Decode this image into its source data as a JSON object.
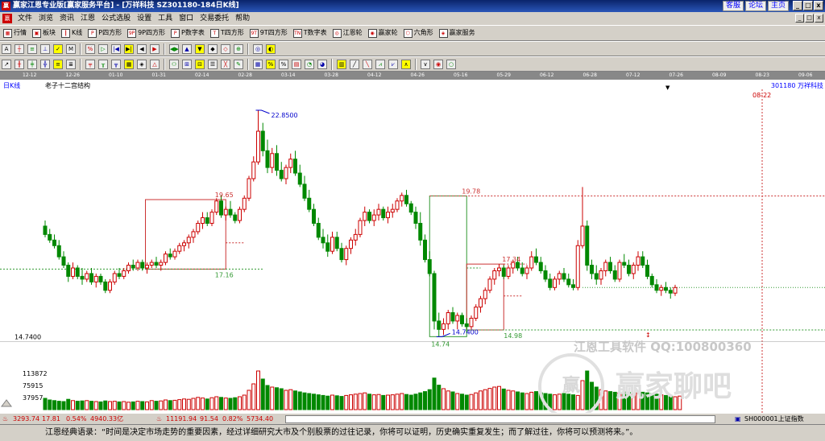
{
  "titlebar": {
    "app_icon": "赢",
    "title": "赢家江恩专业版[赢家服务平台] - [万祥科技   SZ301180-184日K线]",
    "links": [
      "客服",
      "论坛",
      "主页"
    ],
    "win_buttons": [
      "_",
      "□",
      "x"
    ]
  },
  "menubar": {
    "icon": "赢",
    "items": [
      "文件",
      "浏览",
      "资讯",
      "江恩",
      "公式选股",
      "设置",
      "工具",
      "窗口",
      "交易委托",
      "帮助"
    ],
    "mdi_buttons": [
      "_",
      "□",
      "x"
    ]
  },
  "toolbar1": {
    "buttons": [
      {
        "icon": "grid-icon",
        "label": "行情"
      },
      {
        "icon": "blocks-icon",
        "label": "板块"
      },
      {
        "icon": "kline-icon",
        "label": "K线"
      },
      {
        "icon": "p-square-icon",
        "label": "P四方形"
      },
      {
        "icon": "9p-square-icon",
        "label": "9P四方形"
      },
      {
        "icon": "p-number-table-icon",
        "label": "P数字表"
      },
      {
        "icon": "t-square-icon",
        "label": "T四方形"
      },
      {
        "icon": "9t-square-icon",
        "label": "9T四方形"
      },
      {
        "icon": "t-number-table-icon",
        "label": "T数字表"
      },
      {
        "icon": "gann-wheel-icon",
        "label": "江恩轮"
      },
      {
        "icon": "winner-wheel-icon",
        "label": "赢家轮"
      },
      {
        "icon": "hexagon-icon",
        "label": "六角形"
      },
      {
        "icon": "winner-service-icon",
        "label": "赢家服务"
      }
    ]
  },
  "toolbar2": {
    "icons": [
      "A",
      "┼",
      "≡",
      "⊥",
      "✓",
      "M",
      "%",
      "▷",
      "|◀",
      "▶|",
      "◀",
      "▶",
      "◀▶",
      "▲",
      "▼",
      "◆",
      "◇",
      "⊕",
      "◎",
      "◐"
    ]
  },
  "toolbar3": {
    "icons": [
      "↗",
      "╫",
      "╪",
      "╬",
      "≡",
      "≣",
      "╤",
      "╥",
      "╦",
      "▦",
      "◈",
      "△",
      "⚇",
      "⊞",
      "⊟",
      "☰",
      "╳",
      "✎",
      "▦",
      "%",
      "%",
      "▤",
      "◔",
      "◕",
      "▥",
      "╱",
      "╲",
      "⩘",
      "⩗",
      "∧",
      "∨",
      "◉",
      "○"
    ]
  },
  "chart_header": {
    "period": "日K线",
    "indicator_title": "老子十二宫结构",
    "stock": "301180 万祥科技",
    "date_marker": "08-22"
  },
  "date_axis": [
    "12-12",
    "12-26",
    "01-10",
    "01-31",
    "02-14",
    "02-28",
    "03-14",
    "03-28",
    "04-12",
    "04-26",
    "05-16",
    "05-29",
    "06-12",
    "06-28",
    "07-12",
    "07-26",
    "08-09",
    "08-23",
    "09-06"
  ],
  "chart_data": {
    "type": "candlestick",
    "title": "老子十二宫结构",
    "ylabel": "",
    "ylim": [
      14.0,
      23.6
    ],
    "price_axis_label": "14.7400",
    "up_color": "#cc0000",
    "down_color": "#008800",
    "annotations": {
      "high": "22.8500",
      "low": "14.7400",
      "box_labels": [
        "19.65",
        "17.16",
        "19.78",
        "14.74",
        "17.34",
        "14.98"
      ]
    },
    "candles": [
      [
        18.7,
        18.9,
        18.3,
        18.4
      ],
      [
        18.4,
        18.6,
        18.1,
        18.2
      ],
      [
        18.2,
        18.4,
        17.9,
        18.0
      ],
      [
        18.0,
        18.2,
        17.5,
        17.6
      ],
      [
        17.6,
        17.8,
        17.2,
        17.3
      ],
      [
        17.3,
        17.4,
        16.7,
        16.9
      ],
      [
        16.9,
        17.4,
        16.8,
        17.2
      ],
      [
        17.2,
        17.3,
        16.8,
        16.9
      ],
      [
        16.9,
        17.2,
        16.6,
        16.8
      ],
      [
        16.8,
        17.1,
        16.7,
        17.0
      ],
      [
        17.0,
        17.2,
        16.6,
        16.7
      ],
      [
        16.7,
        17.0,
        16.5,
        16.9
      ],
      [
        16.9,
        17.0,
        16.6,
        16.7
      ],
      [
        16.7,
        16.8,
        16.3,
        16.4
      ],
      [
        16.4,
        16.8,
        16.3,
        16.7
      ],
      [
        16.7,
        17.1,
        16.6,
        17.0
      ],
      [
        17.0,
        17.2,
        16.8,
        16.9
      ],
      [
        16.9,
        17.2,
        16.8,
        17.1
      ],
      [
        17.1,
        17.4,
        17.0,
        17.3
      ],
      [
        17.3,
        17.5,
        17.1,
        17.2
      ],
      [
        17.2,
        17.5,
        17.1,
        17.4
      ],
      [
        17.4,
        17.5,
        17.1,
        17.2
      ],
      [
        17.2,
        17.4,
        17.0,
        17.3
      ],
      [
        17.3,
        17.5,
        17.2,
        17.4
      ],
      [
        17.4,
        17.6,
        17.2,
        17.3
      ],
      [
        17.3,
        17.5,
        17.1,
        17.4
      ],
      [
        17.4,
        17.8,
        17.3,
        17.7
      ],
      [
        17.7,
        17.9,
        17.5,
        17.6
      ],
      [
        17.6,
        17.9,
        17.5,
        17.8
      ],
      [
        17.8,
        18.1,
        17.7,
        18.0
      ],
      [
        18.0,
        18.2,
        17.8,
        18.1
      ],
      [
        18.1,
        18.4,
        17.9,
        18.3
      ],
      [
        18.3,
        18.6,
        18.1,
        18.5
      ],
      [
        18.5,
        18.9,
        18.4,
        18.8
      ],
      [
        18.8,
        19.2,
        18.6,
        19.0
      ],
      [
        19.0,
        19.2,
        18.7,
        18.8
      ],
      [
        18.8,
        19.3,
        18.7,
        19.2
      ],
      [
        19.2,
        19.7,
        19.1,
        19.6
      ],
      [
        19.6,
        19.8,
        19.0,
        19.1
      ],
      [
        19.1,
        19.4,
        18.9,
        19.3
      ],
      [
        19.3,
        19.6,
        19.0,
        19.1
      ],
      [
        19.1,
        19.2,
        18.8,
        18.9
      ],
      [
        18.9,
        19.4,
        18.8,
        19.3
      ],
      [
        19.3,
        19.8,
        19.2,
        19.7
      ],
      [
        19.7,
        20.5,
        19.6,
        20.4
      ],
      [
        20.4,
        21.2,
        20.3,
        21.0
      ],
      [
        21.0,
        22.85,
        20.9,
        22.1
      ],
      [
        22.1,
        22.4,
        21.2,
        21.4
      ],
      [
        21.4,
        21.8,
        20.6,
        20.8
      ],
      [
        20.8,
        21.5,
        20.6,
        21.3
      ],
      [
        21.3,
        21.6,
        20.5,
        20.7
      ],
      [
        20.7,
        21.0,
        20.3,
        20.4
      ],
      [
        20.4,
        20.9,
        20.2,
        20.8
      ],
      [
        20.8,
        21.3,
        20.6,
        21.1
      ],
      [
        21.1,
        21.4,
        20.5,
        20.6
      ],
      [
        20.6,
        20.9,
        20.1,
        20.2
      ],
      [
        20.2,
        20.5,
        19.6,
        19.7
      ],
      [
        19.7,
        20.0,
        19.2,
        19.3
      ],
      [
        19.3,
        19.5,
        18.7,
        18.8
      ],
      [
        18.8,
        19.0,
        18.2,
        18.3
      ],
      [
        18.3,
        18.6,
        17.9,
        18.1
      ],
      [
        18.1,
        18.4,
        17.6,
        17.8
      ],
      [
        17.8,
        18.5,
        17.7,
        18.3
      ],
      [
        18.3,
        18.5,
        17.8,
        17.9
      ],
      [
        17.9,
        18.1,
        17.4,
        17.5
      ],
      [
        17.5,
        18.0,
        17.3,
        17.9
      ],
      [
        17.9,
        18.3,
        17.7,
        18.2
      ],
      [
        18.2,
        18.6,
        18.0,
        18.4
      ],
      [
        18.4,
        19.0,
        18.3,
        18.9
      ],
      [
        18.9,
        19.4,
        18.7,
        19.2
      ],
      [
        19.2,
        19.3,
        18.8,
        18.9
      ],
      [
        18.9,
        19.3,
        18.7,
        19.1
      ],
      [
        19.1,
        19.5,
        18.9,
        19.3
      ],
      [
        19.3,
        19.4,
        18.9,
        19.0
      ],
      [
        19.0,
        19.4,
        18.8,
        19.2
      ],
      [
        19.2,
        19.5,
        19.0,
        19.3
      ],
      [
        19.3,
        19.7,
        19.2,
        19.6
      ],
      [
        19.6,
        19.9,
        19.4,
        19.8
      ],
      [
        19.8,
        20.0,
        19.4,
        19.5
      ],
      [
        19.5,
        19.6,
        19.1,
        19.2
      ],
      [
        19.2,
        19.4,
        18.6,
        18.8
      ],
      [
        18.8,
        19.2,
        18.0,
        18.2
      ],
      [
        18.2,
        18.4,
        17.4,
        17.5
      ],
      [
        17.5,
        17.8,
        16.9,
        17.0
      ],
      [
        17.0,
        17.1,
        15.0,
        15.3
      ],
      [
        15.3,
        15.6,
        14.74,
        15.0
      ],
      [
        15.0,
        15.4,
        14.8,
        15.2
      ],
      [
        15.2,
        15.7,
        15.0,
        15.6
      ],
      [
        15.6,
        15.8,
        15.2,
        15.3
      ],
      [
        15.3,
        15.6,
        15.0,
        15.5
      ],
      [
        15.5,
        15.6,
        15.1,
        15.2
      ],
      [
        15.2,
        15.4,
        14.9,
        15.1
      ],
      [
        15.1,
        15.5,
        15.0,
        15.4
      ],
      [
        15.4,
        15.9,
        15.3,
        15.8
      ],
      [
        15.8,
        16.2,
        15.6,
        16.1
      ],
      [
        16.1,
        16.5,
        15.9,
        16.4
      ],
      [
        16.4,
        16.9,
        16.3,
        16.8
      ],
      [
        16.8,
        17.2,
        16.6,
        17.1
      ],
      [
        17.1,
        17.34,
        16.9,
        17.2
      ],
      [
        17.2,
        17.3,
        16.8,
        16.9
      ],
      [
        16.9,
        17.3,
        16.8,
        17.2
      ],
      [
        17.2,
        17.5,
        17.0,
        17.4
      ],
      [
        17.4,
        17.6,
        17.1,
        17.2
      ],
      [
        17.2,
        17.4,
        16.9,
        17.0
      ],
      [
        17.0,
        17.3,
        16.8,
        17.2
      ],
      [
        17.2,
        17.8,
        17.1,
        17.6
      ],
      [
        17.6,
        17.9,
        17.3,
        17.4
      ],
      [
        17.4,
        17.6,
        17.0,
        17.1
      ],
      [
        17.1,
        17.3,
        16.7,
        16.8
      ],
      [
        16.8,
        17.0,
        16.4,
        16.5
      ],
      [
        16.5,
        16.9,
        16.4,
        16.8
      ],
      [
        16.8,
        17.1,
        16.6,
        17.0
      ],
      [
        17.0,
        17.2,
        16.7,
        16.8
      ],
      [
        16.8,
        17.0,
        16.5,
        16.6
      ],
      [
        16.6,
        16.8,
        16.4,
        16.5
      ],
      [
        16.5,
        18.2,
        16.4,
        18.0
      ],
      [
        18.0,
        20.1,
        17.9,
        18.7
      ],
      [
        18.7,
        18.9,
        17.1,
        17.3
      ],
      [
        17.3,
        17.5,
        16.8,
        17.0
      ],
      [
        17.0,
        17.3,
        16.6,
        16.8
      ],
      [
        16.8,
        17.2,
        16.6,
        17.1
      ],
      [
        17.1,
        17.5,
        16.9,
        17.4
      ],
      [
        17.4,
        17.6,
        17.0,
        17.1
      ],
      [
        17.1,
        17.3,
        16.7,
        16.8
      ],
      [
        16.8,
        17.5,
        16.7,
        17.4
      ],
      [
        17.4,
        17.7,
        17.2,
        17.3
      ],
      [
        17.3,
        17.5,
        16.9,
        17.0
      ],
      [
        17.0,
        17.4,
        16.8,
        17.3
      ],
      [
        17.3,
        17.8,
        17.1,
        17.6
      ],
      [
        17.6,
        17.8,
        17.2,
        17.3
      ],
      [
        17.3,
        17.5,
        16.8,
        16.9
      ],
      [
        16.9,
        17.0,
        16.5,
        16.6
      ],
      [
        16.6,
        16.8,
        16.3,
        16.4
      ],
      [
        16.4,
        16.6,
        16.2,
        16.5
      ],
      [
        16.5,
        16.7,
        16.3,
        16.4
      ],
      [
        16.4,
        16.5,
        16.1,
        16.3
      ],
      [
        16.3,
        16.6,
        16.2,
        16.5
      ]
    ],
    "volume_axis": [
      "113872",
      "75915",
      "37957"
    ],
    "volume": [
      35,
      30,
      28,
      26,
      25,
      32,
      28,
      26,
      27,
      28,
      26,
      25,
      24,
      27,
      25,
      26,
      24,
      25,
      23,
      24,
      26,
      25,
      24,
      28,
      26,
      27,
      30,
      28,
      29,
      31,
      33,
      32,
      35,
      38,
      36,
      33,
      37,
      40,
      38,
      36,
      35,
      37,
      40,
      45,
      60,
      80,
      120,
      95,
      75,
      70,
      68,
      65,
      60,
      62,
      58,
      55,
      52,
      50,
      48,
      46,
      44,
      42,
      45,
      43,
      41,
      44,
      46,
      48,
      50,
      52,
      48,
      46,
      47,
      44,
      45,
      46,
      48,
      50,
      47,
      45,
      48,
      52,
      56,
      62,
      98,
      76,
      65,
      58,
      55,
      50,
      48,
      45,
      47,
      52,
      58,
      62,
      66,
      70,
      72,
      64,
      60,
      58,
      55,
      52,
      50,
      54,
      56,
      52,
      50,
      48,
      46,
      48,
      50,
      48,
      46,
      44,
      90,
      120,
      85,
      70,
      62,
      58,
      56,
      54,
      52,
      55,
      53,
      50,
      52,
      54,
      52,
      50,
      48,
      46,
      44,
      42,
      40,
      42
    ]
  },
  "statusbar": {
    "icon": "flame-icon",
    "sh_index": "3293.74",
    "sh_change": "17.81",
    "sh_pct": "0.54%",
    "sh_amount": "4940.33亿",
    "sz_index": "11191.94",
    "sz_change": "91.54",
    "sz_pct": "0.82%",
    "sz_amount": "5734.40",
    "right_code": "SH000001上证指数"
  },
  "watermark": {
    "line1": "江恩工具软件  QQ:100800360",
    "line2": "赢家聊吧",
    "logo": "赢"
  },
  "quote": {
    "text": "江恩经典语录：“时间是决定市场走势的重要因素，经过详细研究大市及个别股票的过往记录，你将可以证明，历史确实重复发生；而了解过往，你将可以预测将来。”。"
  }
}
